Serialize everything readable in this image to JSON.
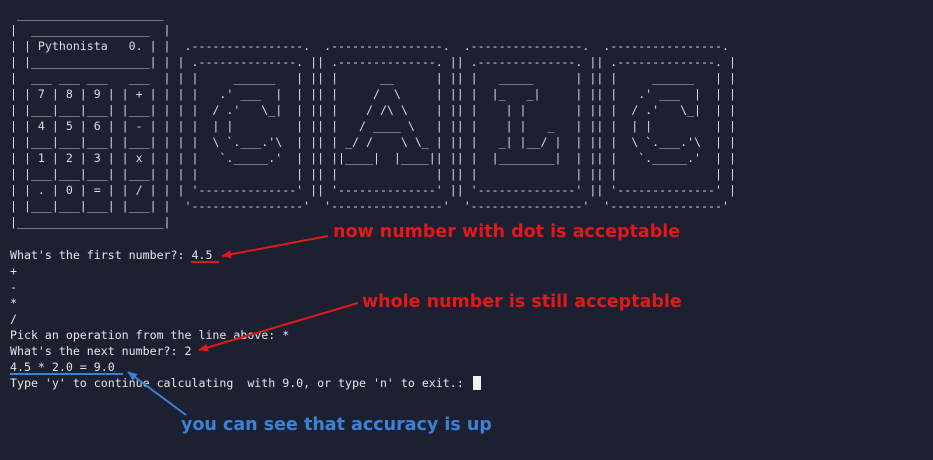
{
  "ascii_art": " _____________________\n|  _________________  |\n| | Pythonista   0. | |  .----------------.  .----------------.  .----------------.  .----------------.\n| |_________________| | | .--------------. || .--------------. || .--------------. || .--------------. |\n|  ___ ___ ___   ___  | | |     ______   | || |      __      | || |   _____      | || |     ______   | |\n| | 7 | 8 | 9 | | + | | | |   .' ___  |  | || |     /  \\     | || |  |_   _|     | || |   .' ___  |  | |\n| |___|___|___| |___| | | |  / .'   \\_|  | || |    / /\\ \\    | || |    | |       | || |  / .'   \\_|  | |\n| | 4 | 5 | 6 | | - | | | |  | |         | || |   / ____ \\   | || |    | |   _   | || |  | |         | |\n| |___|___|___| |___| | | |  \\ `.___.'\\  | || | _/ /    \\ \\_ | || |   _| |__/ |  | || |  \\ `.___.'\\  | |\n| | 1 | 2 | 3 | | x | | | |   `._____.'  | || ||____|  |____|| || |  |________|  | || |   `._____.'  | |\n| |___|___|___| |___| | | |              | || |              | || |              | || |              | |\n| | . | 0 | = | | / | | | '--------------' || '--------------' || '--------------' || '--------------' |\n| |___|___|___| |___| |  '----------------'  '----------------'  '----------------'  '----------------'\n|_____________________|",
  "terminal": {
    "lines": [
      "What's the first number?: 4.5",
      "+",
      "-",
      "*",
      "/",
      "Pick an operation from the line above: *",
      "What's the next number?: 2",
      "4.5 * 2.0 = 9.0",
      "Type 'y' to continue calculating  with 9.0, or type 'n' to exit.: "
    ]
  },
  "annotations": {
    "dot_note": "now number with dot is acceptable",
    "whole_note": "whole number is still acceptable",
    "accuracy_note": "you can see that accuracy is up"
  },
  "colors": {
    "background": "#1c2031",
    "text": "#e6e6e6",
    "annotation_red": "#e01a1a",
    "annotation_blue": "#3b82d6"
  }
}
